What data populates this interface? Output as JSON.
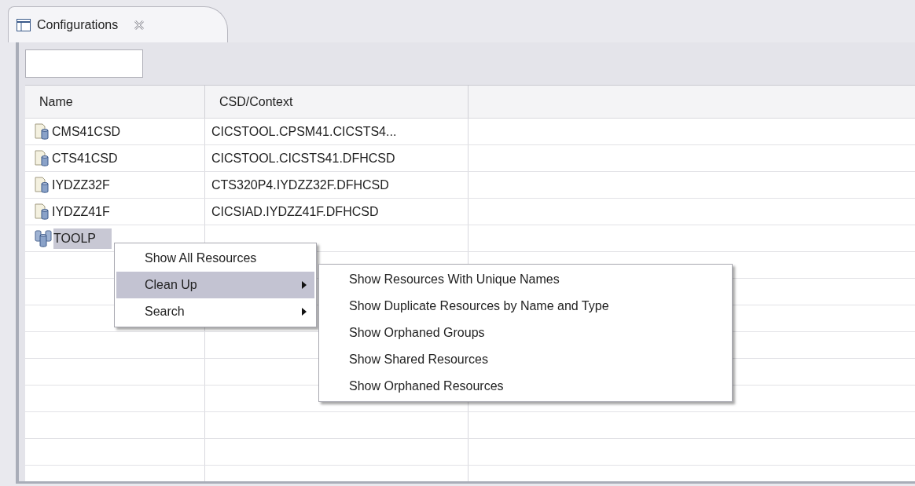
{
  "tab": {
    "title": "Configurations",
    "selected": true
  },
  "table": {
    "columns": [
      "Name",
      "CSD/Context"
    ],
    "rows": [
      {
        "kind": "csd",
        "name": "CMS41CSD",
        "context": "CICSTOOL.CPSM41.CICSTS4...",
        "selected": false
      },
      {
        "kind": "csd",
        "name": "CTS41CSD",
        "context": "CICSTOOL.CICSTS41.DFHCSD",
        "selected": false
      },
      {
        "kind": "csd",
        "name": "IYDZZ32F",
        "context": "CTS320P4.IYDZZ32F.DFHCSD",
        "selected": false
      },
      {
        "kind": "csd",
        "name": "IYDZZ41F",
        "context": "CICSIAD.IYDZZ41F.DFHCSD",
        "selected": false
      },
      {
        "kind": "group",
        "name": "TOOLP",
        "selected": true
      }
    ]
  },
  "context_menu": {
    "items": [
      {
        "label": "Show All Resources",
        "has_submenu": false,
        "selected": false
      },
      {
        "label": "Clean Up",
        "has_submenu": true,
        "selected": true,
        "children": [
          {
            "label": "Show Resources With Unique Names"
          },
          {
            "label": "Show Duplicate Resources by Name and Type"
          },
          {
            "label": "Show Orphaned Groups"
          },
          {
            "label": "Show Shared Resources"
          },
          {
            "label": "Show Orphaned Resources"
          }
        ]
      },
      {
        "label": "Search",
        "has_submenu": true,
        "selected": false
      }
    ]
  }
}
